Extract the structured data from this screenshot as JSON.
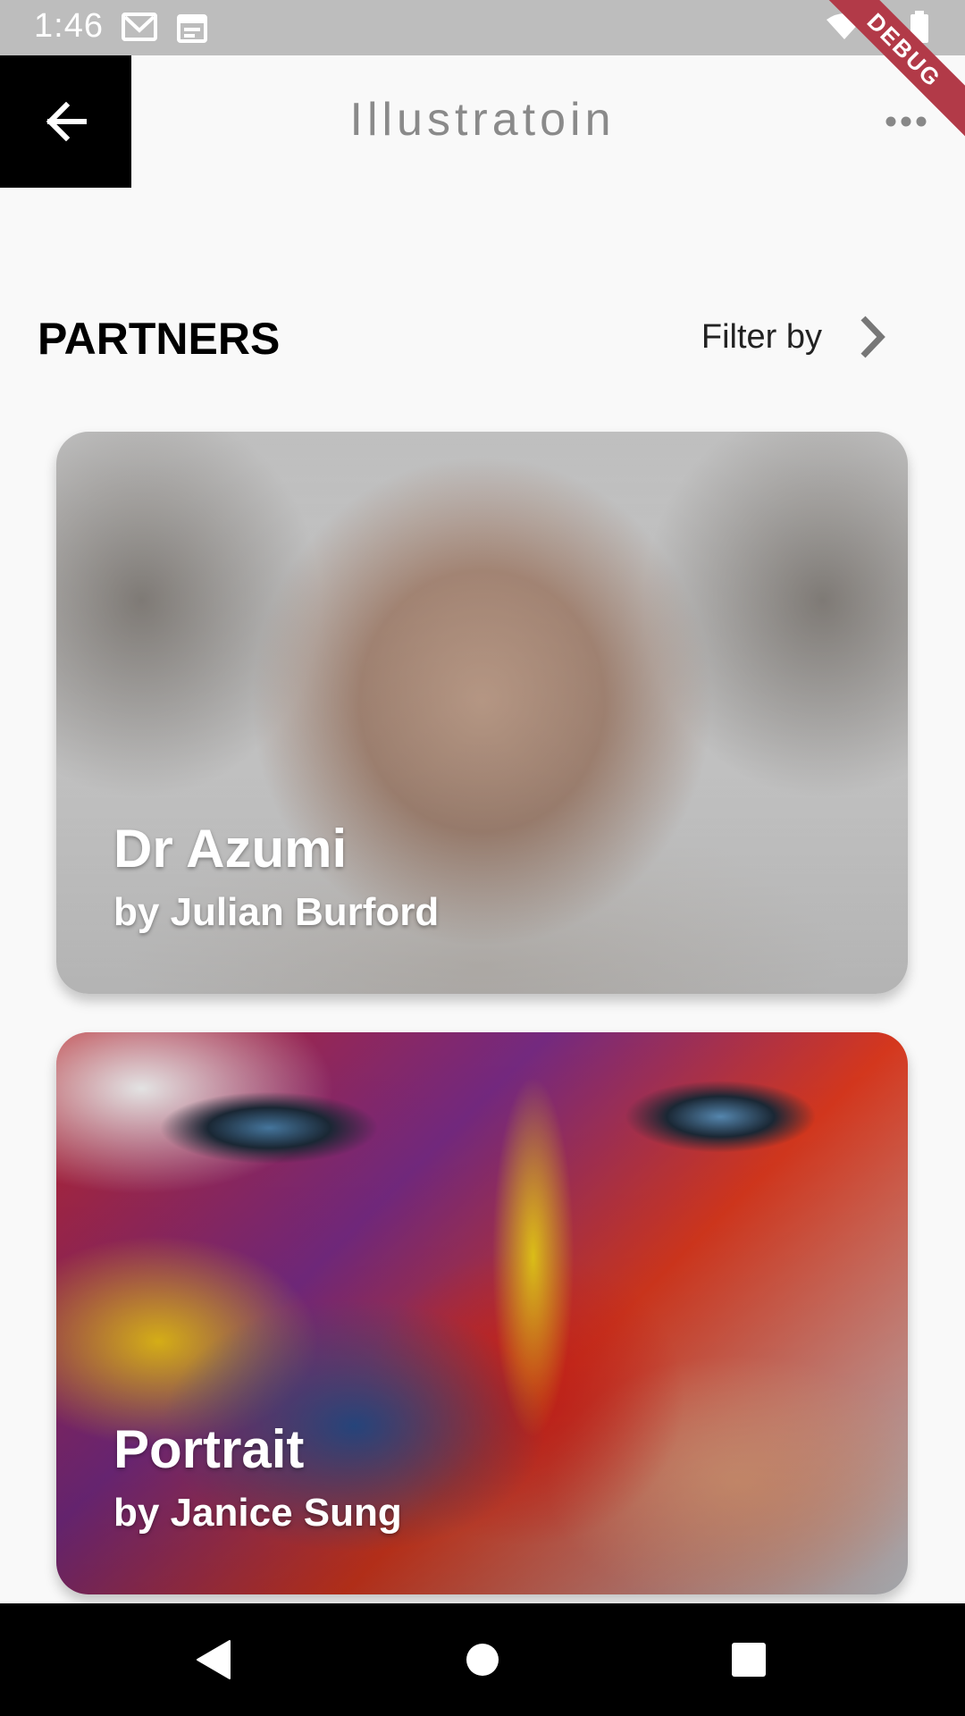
{
  "status_bar": {
    "time": "1:46",
    "icons": [
      "gmail-icon",
      "calendar-icon",
      "wifi-icon",
      "signal-icon",
      "battery-icon"
    ],
    "background": "#bdbdbd"
  },
  "debug_banner": {
    "label": "DEBUG",
    "color": "#b23a48"
  },
  "app_bar": {
    "title": "Illustratoin",
    "back_icon": "arrow-left-icon",
    "more_icon": "more-horizontal-icon"
  },
  "section": {
    "title": "PARTNERS",
    "filter_label": "Filter by",
    "filter_icon": "chevron-right-icon"
  },
  "cards": [
    {
      "title": "Dr Azumi",
      "subtitle": "by Julian Burford"
    },
    {
      "title": "Portrait",
      "subtitle": "by Janice Sung"
    }
  ],
  "nav_bar": {
    "icons": [
      "nav-back-icon",
      "nav-home-icon",
      "nav-recent-icon"
    ]
  }
}
